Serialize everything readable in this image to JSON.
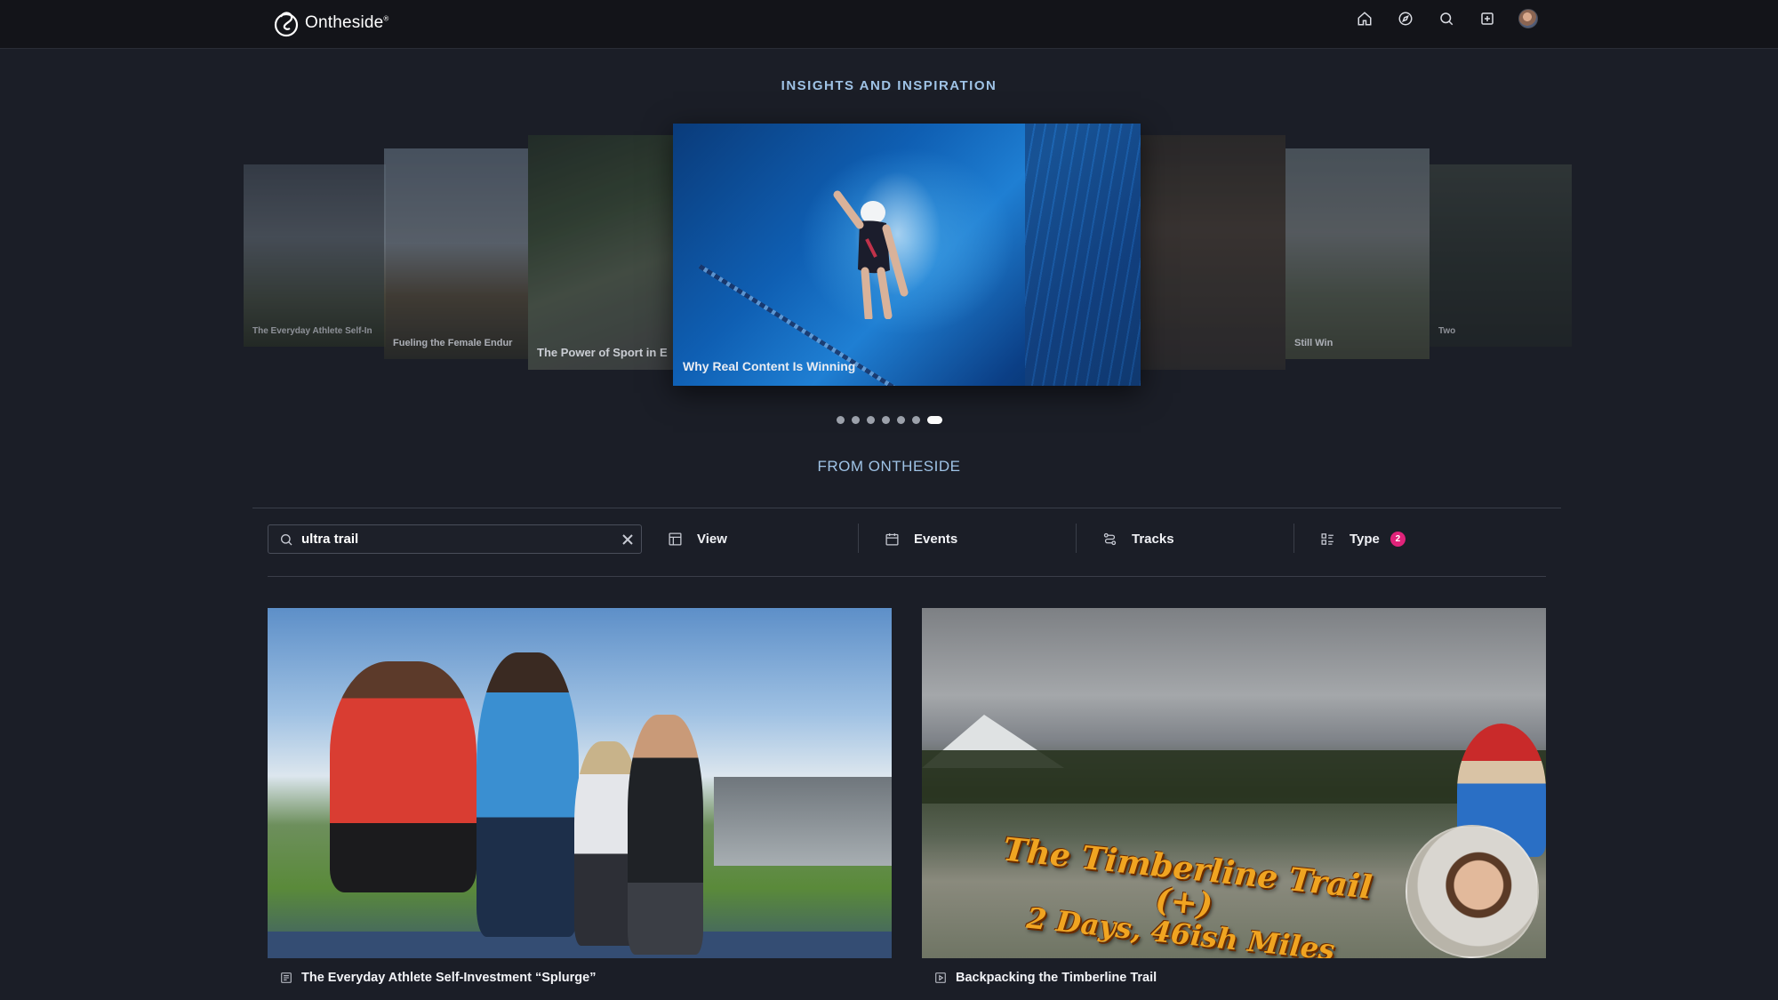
{
  "header": {
    "brand": "Ontheside",
    "brand_mark": "®",
    "icons": [
      "home-icon",
      "compass-icon",
      "search-icon",
      "add-icon",
      "avatar"
    ]
  },
  "insights": {
    "heading": "INSIGHTS AND INSPIRATION",
    "slides": [
      {
        "caption": "The Everyday Athlete Self-In"
      },
      {
        "caption": "Fueling the Female Endur"
      },
      {
        "caption": "The Power of Sport in E"
      },
      {
        "caption": "Why Real Content Is Winning"
      },
      {
        "caption": ""
      },
      {
        "caption": "Still Win"
      },
      {
        "caption": "Two"
      }
    ],
    "active_dot": 6,
    "dot_count": 7
  },
  "from": {
    "heading": "FROM ONTHESIDE"
  },
  "filters": {
    "search_value": "ultra trail",
    "view_label": "View",
    "events_label": "Events",
    "tracks_label": "Tracks",
    "type_label": "Type",
    "type_count": "2"
  },
  "cards": [
    {
      "title": "The Everyday Athlete Self-Investment “Splurge”",
      "icon": "article-icon"
    },
    {
      "title": "Backpacking the Timberline Trail",
      "icon": "video-play-icon",
      "overlay_line1": "The Timberline Trail (+)",
      "overlay_line2": "2 Days, 46ish Miles"
    }
  ],
  "colors": {
    "background": "#1b1e27",
    "topbar": "#131419",
    "heading_accent": "#9fc3e6",
    "badge": "#e0237a"
  }
}
